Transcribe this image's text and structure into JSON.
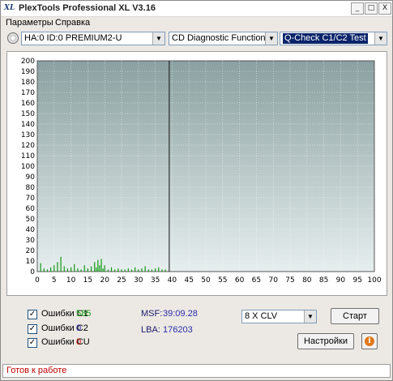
{
  "window": {
    "title": "PlexTools Professional XL V3.16",
    "icon_label": "XL",
    "controls": [
      "_",
      "□",
      "X"
    ]
  },
  "menu": {
    "items": [
      "Параметры",
      "Справка"
    ]
  },
  "toolbar": {
    "drive": "HA:0 ID:0  PREMIUM2-U",
    "function": "CD Diagnostic Functions",
    "test": "Q-Check C1/C2 Test"
  },
  "chart_data": {
    "type": "bar",
    "title": "",
    "xlabel": "",
    "ylabel": "",
    "xlim": [
      0,
      100
    ],
    "ylim": [
      0,
      200
    ],
    "x_ticks": [
      0,
      5,
      10,
      15,
      20,
      25,
      30,
      35,
      40,
      45,
      50,
      55,
      60,
      65,
      70,
      75,
      80,
      85,
      90,
      95,
      100
    ],
    "y_ticks": [
      0,
      10,
      20,
      30,
      40,
      50,
      60,
      70,
      80,
      90,
      100,
      110,
      120,
      130,
      140,
      150,
      160,
      170,
      180,
      190,
      200
    ],
    "grid": true,
    "progress_x": 39.15,
    "series": [
      {
        "color": "#119911",
        "x": [
          1,
          2,
          3,
          4,
          5,
          6,
          7,
          8,
          9,
          10,
          11,
          12,
          13,
          14,
          15,
          16,
          17,
          17.5,
          18,
          18.5,
          19,
          19.5,
          20,
          21,
          22,
          23,
          24,
          25,
          26,
          27,
          28,
          29,
          30,
          31,
          32,
          33,
          34,
          35,
          36,
          37,
          38
        ],
        "values": [
          8,
          3,
          2,
          4,
          6,
          9,
          14,
          5,
          3,
          4,
          7,
          3,
          2,
          6,
          3,
          5,
          9,
          4,
          11,
          6,
          12,
          3,
          6,
          2,
          4,
          2,
          3,
          2,
          2,
          3,
          2,
          4,
          2,
          3,
          5,
          2,
          2,
          3,
          4,
          2,
          2
        ]
      }
    ],
    "colors": {
      "plot_top": "#8aa0a0",
      "plot_bottom": "#e6eeee",
      "grid": "#ffffff",
      "progress_line": "#111111"
    }
  },
  "errors": {
    "c1": {
      "label": "Ошибки C1",
      "value": "585",
      "color": "#16a016",
      "checked": true
    },
    "c2": {
      "label": "Ошибки C2",
      "value": "0",
      "color": "#1a1aa0",
      "checked": true
    },
    "cu": {
      "label": "Ошибки CU",
      "value": "0",
      "color": "#cc0000",
      "checked": true
    }
  },
  "position": {
    "msf_label": "MSF:",
    "msf_value": "39:09.28",
    "lba_label": "LBA:",
    "lba_value": "176203"
  },
  "controls": {
    "speed": "8 X CLV",
    "start_label": "Старт",
    "settings_label": "Настройки",
    "info_icon": "i"
  },
  "status": {
    "text": "Готов к работе"
  }
}
